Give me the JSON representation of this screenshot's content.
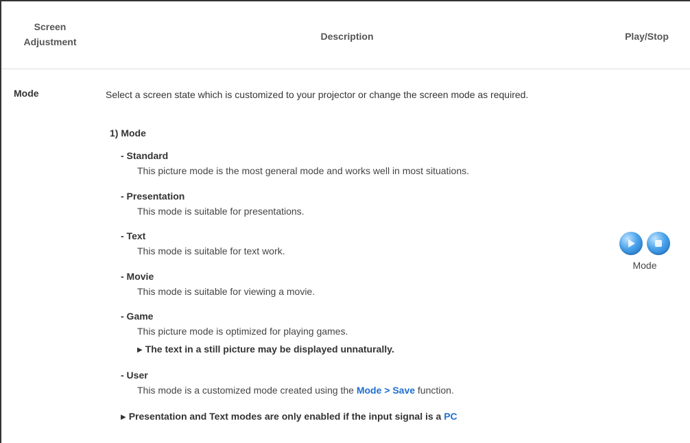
{
  "header": {
    "col1_line1": "Screen",
    "col1_line2": "Adjustment",
    "col2": "Description",
    "col3": "Play/Stop"
  },
  "row": {
    "label": "Mode",
    "description": "Select a screen state which is customized to your projector or change the screen mode as required.",
    "section_title": "1) Mode",
    "items": [
      {
        "name": "- Standard",
        "text": "This picture mode is the most general mode and works well in most situations."
      },
      {
        "name": "- Presentation",
        "text": "This mode is suitable for presentations."
      },
      {
        "name": "- Text",
        "text": "This mode is suitable for text work."
      },
      {
        "name": "- Movie",
        "text": "This mode is suitable for viewing a movie."
      },
      {
        "name": "- Game",
        "text": "This picture mode is optimized for playing games.",
        "note": "The text in a still picture may be displayed unnaturally."
      },
      {
        "name": "- User",
        "text_before": "This mode is a customized mode created using the ",
        "link": "Mode > Save",
        "text_after": " function."
      }
    ],
    "final_note_before": "Presentation and Text modes are only enabled if the input signal is a ",
    "final_note_link": "PC",
    "play_caption": "Mode"
  },
  "icons": {
    "play": "play-icon",
    "stop": "stop-icon",
    "note_marker": "triangle-right-icon"
  },
  "colors": {
    "link": "#1e6fd0",
    "button": "#4aa3ec"
  }
}
